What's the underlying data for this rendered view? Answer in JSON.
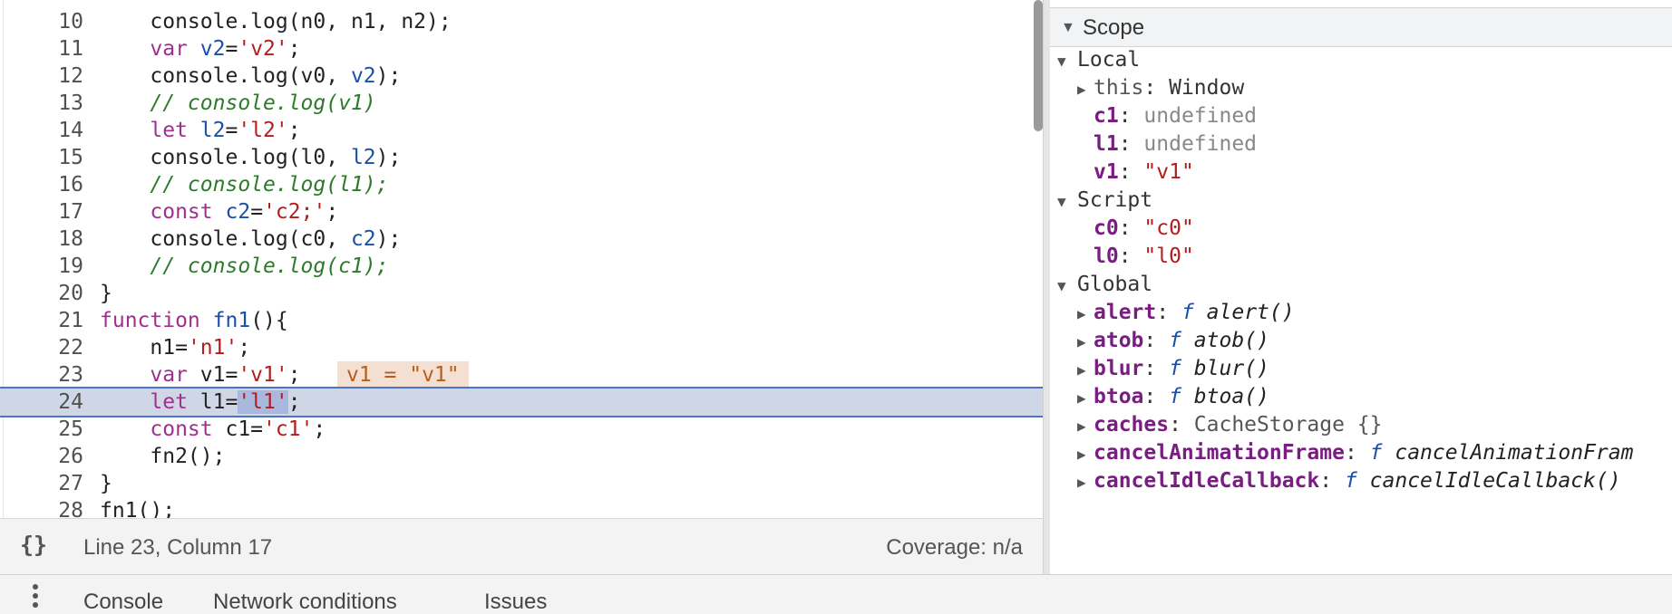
{
  "editor": {
    "lines": [
      {
        "num": "10",
        "parts": [
          [
            "",
            "    console.log(n0, n1, n2);"
          ]
        ]
      },
      {
        "num": "11",
        "parts": [
          [
            "",
            "    "
          ],
          [
            "kw",
            "var"
          ],
          [
            "",
            " "
          ],
          [
            "var",
            "v2"
          ],
          [
            "",
            "="
          ],
          [
            "str",
            "'v2'"
          ],
          [
            "",
            ";"
          ]
        ]
      },
      {
        "num": "12",
        "parts": [
          [
            "",
            "    console.log(v0, "
          ],
          [
            "var",
            "v2"
          ],
          [
            "",
            ");"
          ]
        ]
      },
      {
        "num": "13",
        "parts": [
          [
            "cm",
            "    // console.log(v1)"
          ]
        ]
      },
      {
        "num": "14",
        "parts": [
          [
            "",
            "    "
          ],
          [
            "kw",
            "let"
          ],
          [
            "",
            " "
          ],
          [
            "var",
            "l2"
          ],
          [
            "",
            "="
          ],
          [
            "str",
            "'l2'"
          ],
          [
            "",
            ";"
          ]
        ]
      },
      {
        "num": "15",
        "parts": [
          [
            "",
            "    console.log(l0, "
          ],
          [
            "var",
            "l2"
          ],
          [
            "",
            ");"
          ]
        ]
      },
      {
        "num": "16",
        "parts": [
          [
            "cm",
            "    // console.log(l1);"
          ]
        ]
      },
      {
        "num": "17",
        "parts": [
          [
            "",
            "    "
          ],
          [
            "kw",
            "const"
          ],
          [
            "",
            " "
          ],
          [
            "var",
            "c2"
          ],
          [
            "",
            "="
          ],
          [
            "str",
            "'c2;'"
          ],
          [
            "",
            ";"
          ]
        ]
      },
      {
        "num": "18",
        "parts": [
          [
            "",
            "    console.log(c0, "
          ],
          [
            "var",
            "c2"
          ],
          [
            "",
            ");"
          ]
        ]
      },
      {
        "num": "19",
        "parts": [
          [
            "cm",
            "    // console.log(c1);"
          ]
        ]
      },
      {
        "num": "20",
        "parts": [
          [
            "",
            "}"
          ]
        ]
      },
      {
        "num": "21",
        "parts": [
          [
            "kw",
            "function"
          ],
          [
            "",
            " "
          ],
          [
            "var",
            "fn1"
          ],
          [
            "",
            "(){"
          ]
        ]
      },
      {
        "num": "22",
        "parts": [
          [
            "",
            "    n1="
          ],
          [
            "str",
            "'n1'"
          ],
          [
            "",
            ";"
          ]
        ]
      },
      {
        "num": "23",
        "parts": [
          [
            "",
            "    "
          ],
          [
            "kw",
            "var"
          ],
          [
            "",
            " v1="
          ],
          [
            "str",
            "'v1'"
          ],
          [
            "",
            ";"
          ]
        ]
      },
      {
        "num": "24",
        "parts": [
          [
            "",
            "    "
          ],
          [
            "kw",
            "let"
          ],
          [
            "",
            " l1="
          ],
          [
            "hlstr",
            "'l1'"
          ],
          [
            "",
            ";"
          ]
        ]
      },
      {
        "num": "25",
        "parts": [
          [
            "",
            "    "
          ],
          [
            "kw",
            "const"
          ],
          [
            "",
            " c1="
          ],
          [
            "str",
            "'c1'"
          ],
          [
            "",
            ";"
          ]
        ]
      },
      {
        "num": "26",
        "parts": [
          [
            "",
            "    fn2();"
          ]
        ]
      },
      {
        "num": "27",
        "parts": [
          [
            "",
            "}"
          ]
        ]
      },
      {
        "num": "28",
        "parts": [
          [
            "",
            "fn1();"
          ]
        ]
      }
    ],
    "inline_value": "v1 = \"v1\"",
    "active_line": "24"
  },
  "status": {
    "braces": "{}",
    "cursor_position": "Line 23, Column 17",
    "coverage": "Coverage: n/a"
  },
  "scope": {
    "title": "Scope",
    "rows": [
      {
        "kind": "section",
        "label": "Local"
      },
      {
        "kind": "prop",
        "expand": true,
        "name": "this",
        "name_style": "plain",
        "value": "Window",
        "value_style": "obj"
      },
      {
        "kind": "prop",
        "expand": false,
        "name": "c1",
        "name_style": "bold",
        "value": "undefined",
        "value_style": "undef"
      },
      {
        "kind": "prop",
        "expand": false,
        "name": "l1",
        "name_style": "bold",
        "value": "undefined",
        "value_style": "undef"
      },
      {
        "kind": "prop",
        "expand": false,
        "name": "v1",
        "name_style": "bold",
        "value": "\"v1\"",
        "value_style": "sval"
      },
      {
        "kind": "section",
        "label": "Script"
      },
      {
        "kind": "prop",
        "expand": false,
        "name": "c0",
        "name_style": "bold",
        "value": "\"c0\"",
        "value_style": "sval"
      },
      {
        "kind": "prop",
        "expand": false,
        "name": "l0",
        "name_style": "bold",
        "value": "\"l0\"",
        "value_style": "sval"
      },
      {
        "kind": "section",
        "label": "Global"
      },
      {
        "kind": "prop",
        "expand": true,
        "name": "alert",
        "name_style": "bold",
        "fn": "alert()",
        "value_style": "fn"
      },
      {
        "kind": "prop",
        "expand": true,
        "name": "atob",
        "name_style": "bold",
        "fn": "atob()",
        "value_style": "fn"
      },
      {
        "kind": "prop",
        "expand": true,
        "name": "blur",
        "name_style": "bold",
        "fn": "blur()",
        "value_style": "fn"
      },
      {
        "kind": "prop",
        "expand": true,
        "name": "btoa",
        "name_style": "bold",
        "fn": "btoa()",
        "value_style": "fn"
      },
      {
        "kind": "prop",
        "expand": true,
        "name": "caches",
        "name_style": "bold",
        "value": "CacheStorage {}",
        "value_style": "objlite"
      },
      {
        "kind": "prop",
        "expand": true,
        "name": "cancelAnimationFrame",
        "name_style": "bold",
        "fn": "cancelAnimationFram",
        "value_style": "fn"
      },
      {
        "kind": "prop",
        "expand": true,
        "name": "cancelIdleCallback",
        "name_style": "bold",
        "fn": "cancelIdleCallback()",
        "value_style": "fn"
      }
    ],
    "function_glyph": "f"
  },
  "drawer": {
    "tabs": [
      "Console",
      "Network conditions",
      "Issues"
    ]
  }
}
